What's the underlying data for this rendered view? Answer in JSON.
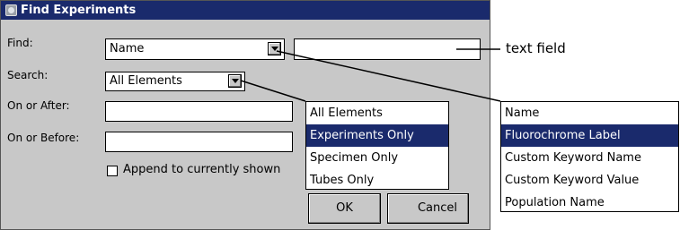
{
  "dialog": {
    "title": "Find Experiments",
    "find_label": "Find:",
    "find_value": "Name",
    "find_text_value": "",
    "search_label": "Search:",
    "search_value": "All Elements",
    "on_or_after_label": "On or After:",
    "on_or_after_value": "",
    "on_or_before_label": "On or Before:",
    "on_or_before_value": "",
    "append_label": "Append to currently shown",
    "append_checked": false,
    "ok_label": "OK",
    "cancel_label": "Cancel"
  },
  "search_popup": {
    "items": [
      {
        "label": "All Elements",
        "selected": false
      },
      {
        "label": "Experiments Only",
        "selected": true
      },
      {
        "label": "Specimen Only",
        "selected": false
      },
      {
        "label": "Tubes Only",
        "selected": false
      }
    ]
  },
  "find_popup": {
    "items": [
      {
        "label": "Name",
        "selected": false
      },
      {
        "label": "Fluorochrome Label",
        "selected": true
      },
      {
        "label": "Custom Keyword Name",
        "selected": false
      },
      {
        "label": "Custom Keyword Value",
        "selected": false
      },
      {
        "label": "Population Name",
        "selected": false
      }
    ]
  },
  "annotation": {
    "text_field": "text field"
  },
  "colors": {
    "title_bar": "#1a2a6c",
    "dialog_bg": "#c8c8c8",
    "selection": "#1a2a6c"
  }
}
